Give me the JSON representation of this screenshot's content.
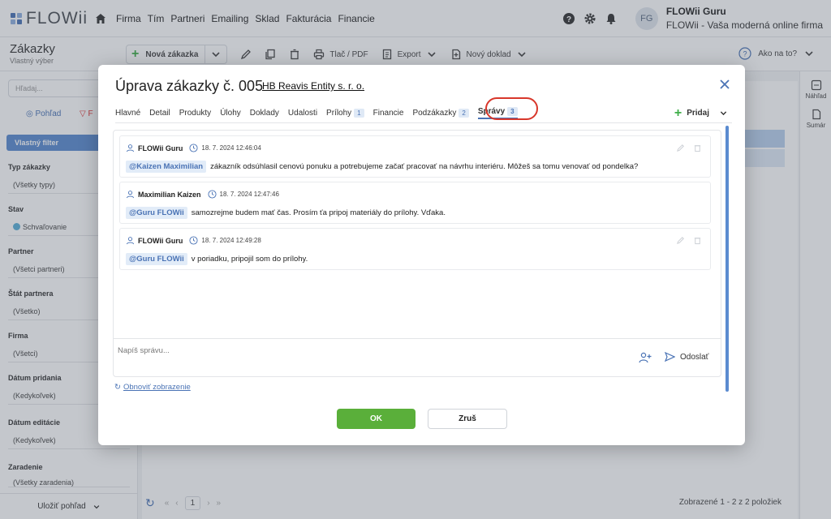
{
  "app": {
    "logo": "FLOWii"
  },
  "nav": [
    "Firma",
    "Tím",
    "Partneri",
    "Emailing",
    "Sklad",
    "Fakturácia",
    "Financie"
  ],
  "user": {
    "initials": "FG",
    "name": "FLOWii Guru",
    "company": "FLOWii - Vaša moderná online firma"
  },
  "page": {
    "title": "Zákazky",
    "subtitle": "Vlastný výber"
  },
  "toolbar": {
    "new": "Nová zákazka",
    "print": "Tlač / PDF",
    "export": "Export",
    "new_doc": "Nový doklad",
    "help": "Ako na to?"
  },
  "sidebar": {
    "search_placeholder": "Hľadaj...",
    "view_tab": "Pohľad",
    "filter_tab": "F",
    "custom_filter": "Vlastný filter",
    "filters": [
      {
        "label": "Typ zákazky",
        "value": "(Všetky typy)"
      },
      {
        "label": "Stav",
        "value": "Schvaľovanie"
      },
      {
        "label": "Partner",
        "value": "(Všetci partneri)"
      },
      {
        "label": "Štát partnera",
        "value": "(Všetko)"
      },
      {
        "label": "Firma",
        "value": "(Všetci)"
      },
      {
        "label": "Dátum pridania",
        "value": "(Kedykoľvek)"
      },
      {
        "label": "Dátum editácie",
        "value": "(Kedykoľvek)"
      },
      {
        "label": "Zaradenie",
        "value": "(Všetky zaradenia)"
      }
    ],
    "save_view": "Uložiť pohľad"
  },
  "right_rail": {
    "preview": "Náhľad",
    "summary": "Sumár"
  },
  "pager": {
    "page": "1",
    "count": "Zobrazené 1 - 2 z 2 položiek"
  },
  "modal": {
    "title": "Úprava zákazky č. 005",
    "partner_link": "HB Reavis Entity s. r. o.",
    "tabs": [
      {
        "label": "Hlavné"
      },
      {
        "label": "Detail"
      },
      {
        "label": "Produkty"
      },
      {
        "label": "Úlohy"
      },
      {
        "label": "Doklady"
      },
      {
        "label": "Udalosti"
      },
      {
        "label": "Prílohy",
        "badge": "1"
      },
      {
        "label": "Financie"
      },
      {
        "label": "Podzákazky",
        "badge": "2"
      },
      {
        "label": "Správy",
        "badge": "3"
      }
    ],
    "add_label": "Pridaj",
    "messages": [
      {
        "author": "FLOWii Guru",
        "time": "18. 7. 2024 12:46:04",
        "mention": "@Kaizen Maximilian",
        "text": "zákazník odsúhlasil cenovú ponuku a potrebujeme začať pracovať na návrhu interiéru. Môžeš sa tomu venovať od pondelka?"
      },
      {
        "author": "Maximilian Kaizen",
        "time": "18. 7. 2024 12:47:46",
        "mention": "@Guru FLOWii",
        "text": "samozrejme budem mať čas. Prosím ťa pripoj materiály do prílohy. Vďaka."
      },
      {
        "author": "FLOWii Guru",
        "time": "18. 7. 2024 12:49:28",
        "mention": "@Guru FLOWii",
        "text": "v poriadku, pripojil som do prílohy."
      }
    ],
    "compose_placeholder": "Napíš správu...",
    "send": "Odoslať",
    "refresh": "Obnoviť zobrazenie",
    "ok": "OK",
    "cancel": "Zruš"
  },
  "colors": {
    "accent": "#4a73b5",
    "ok": "#5aaf3a",
    "highlight": "#d8372b"
  }
}
